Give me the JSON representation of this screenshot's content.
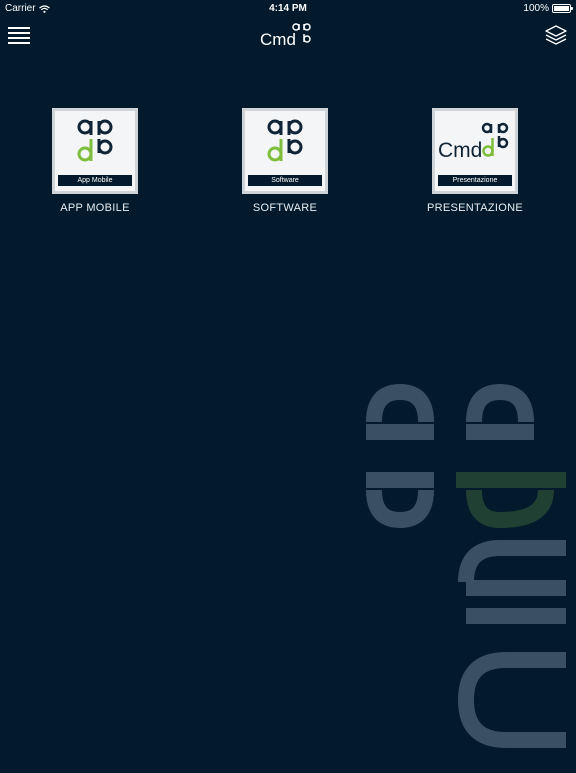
{
  "status_bar": {
    "carrier": "Carrier",
    "time": "4:14 PM",
    "battery": "100%"
  },
  "navbar": {
    "logo_text": "Cmd",
    "menu_icon": "hamburger-menu-icon",
    "layers_icon": "layers-icon"
  },
  "tiles": [
    {
      "band_label": "App Mobile",
      "caption": "APP MOBILE"
    },
    {
      "band_label": "Software",
      "caption": "SOFTWARE"
    },
    {
      "band_label": "Presentazione",
      "caption": "PRESENTAZIONE",
      "logo_text": "Cmd"
    }
  ],
  "watermark": {
    "text": "Cmd"
  },
  "colors": {
    "background": "#021a2c",
    "accent_green": "#7fbe3c",
    "logo_dark": "#0f2436",
    "watermark_gray": "#3a4f61",
    "watermark_green": "#1f4033"
  }
}
